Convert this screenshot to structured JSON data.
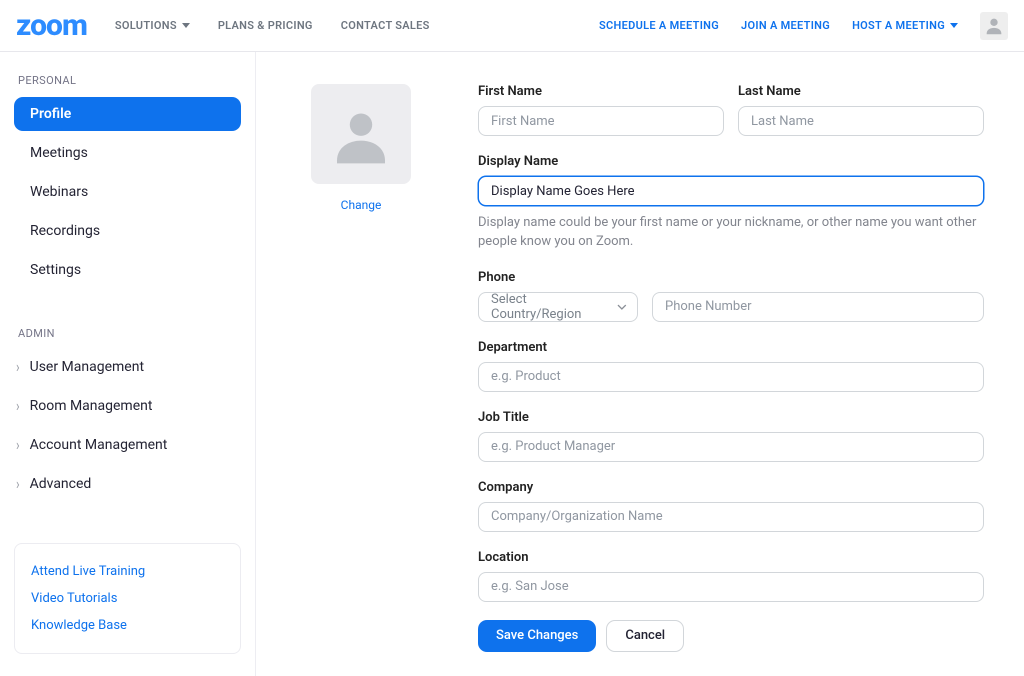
{
  "header": {
    "logo": "zoom",
    "nav": {
      "solutions": "SOLUTIONS",
      "plans": "PLANS & PRICING",
      "contact": "CONTACT SALES"
    },
    "links": {
      "schedule": "SCHEDULE A MEETING",
      "join": "JOIN A MEETING",
      "host": "HOST A MEETING"
    }
  },
  "sidebar": {
    "personal_title": "PERSONAL",
    "personal": {
      "profile": "Profile",
      "meetings": "Meetings",
      "webinars": "Webinars",
      "recordings": "Recordings",
      "settings": "Settings"
    },
    "admin_title": "ADMIN",
    "admin": {
      "user": "User Management",
      "room": "Room Management",
      "account": "Account Management",
      "advanced": "Advanced"
    },
    "help": {
      "training": "Attend Live Training",
      "tutorials": "Video Tutorials",
      "kb": "Knowledge Base"
    }
  },
  "profile": {
    "change": "Change",
    "first_name_label": "First Name",
    "first_name_placeholder": "First Name",
    "last_name_label": "Last Name",
    "last_name_placeholder": "Last Name",
    "display_name_label": "Display Name",
    "display_name_value": "Display Name Goes Here",
    "display_name_help": "Display name could be your first name or your nickname, or other name you want other people know you on Zoom.",
    "phone_label": "Phone",
    "phone_select": "Select Country/Region",
    "phone_placeholder": "Phone Number",
    "department_label": "Department",
    "department_placeholder": "e.g. Product",
    "jobtitle_label": "Job Title",
    "jobtitle_placeholder": "e.g. Product Manager",
    "company_label": "Company",
    "company_placeholder": "Company/Organization Name",
    "location_label": "Location",
    "location_placeholder": "e.g. San Jose",
    "save": "Save Changes",
    "cancel": "Cancel"
  }
}
